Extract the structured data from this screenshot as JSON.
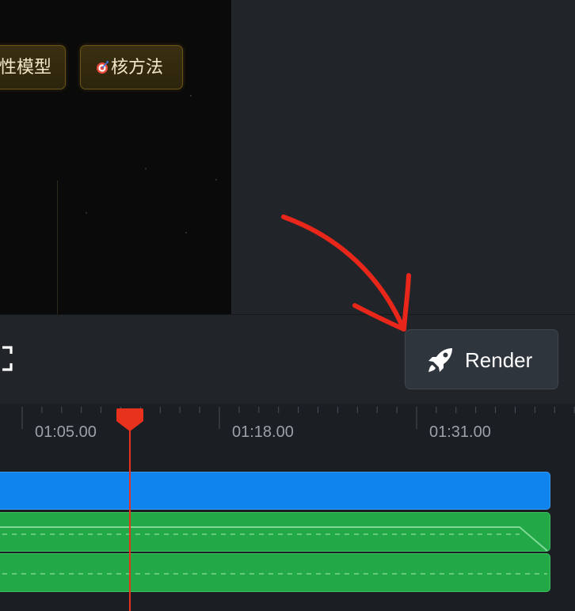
{
  "preview": {
    "tags": [
      {
        "label": "性模型"
      },
      {
        "icon": "target-icon",
        "label": "核方法"
      }
    ]
  },
  "toolbar": {
    "render_label": "Render",
    "render_icon": "rocket-icon",
    "fullscreen_icon": "fullscreen-icon"
  },
  "timeline": {
    "ticks": [
      "01:05.00",
      "01:18.00",
      "01:31.00"
    ],
    "playhead_time": null,
    "tracks": [
      {
        "type": "video",
        "color": "#0f83ee"
      },
      {
        "type": "audio",
        "color": "#22a847"
      },
      {
        "type": "audio",
        "color": "#22a847"
      }
    ]
  },
  "colors": {
    "accent_arrow": "#e8261a",
    "playhead": "#e8321d",
    "tag_border": "#6b5516"
  }
}
